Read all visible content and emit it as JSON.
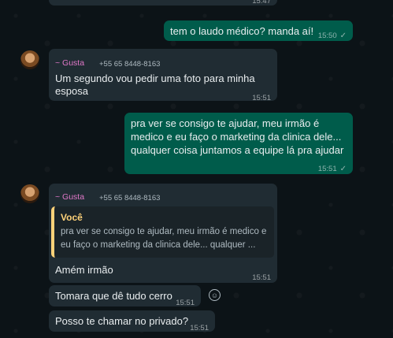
{
  "messages": {
    "top_partial": {
      "time": "15:47"
    },
    "m1": {
      "text": "tem o laudo médico? manda aí!",
      "time": "15:50",
      "status": "✓"
    },
    "m2": {
      "sender": "~ Gusta",
      "phone": "+55 65 8448-8163",
      "lines": [
        "Um segundo vou pedir uma foto para minha",
        "esposa"
      ],
      "time": "15:51"
    },
    "m3": {
      "lines": [
        "pra ver se consigo te ajudar, meu irmão é",
        "medico e eu faço o marketing da clinica dele...",
        "qualquer coisa juntamos a equipe lá pra ajudar"
      ],
      "time": "15:51",
      "status": "✓"
    },
    "m4": {
      "sender": "~ Gusta",
      "phone": "+55 65 8448-8163",
      "quote_author": "Você",
      "quote_lines": [
        "pra ver se consigo te ajudar, meu irmão é medico e",
        "eu faço o marketing da clinica dele... qualquer ..."
      ],
      "text": "Amém irmão",
      "time": "15:51"
    },
    "m5": {
      "text": "Tomara que dê tudo cerro",
      "time": "15:51"
    },
    "m6": {
      "text": "Posso te chamar no privado?",
      "time": "15:51"
    }
  },
  "icons": {
    "emoji_reaction": "smiley-icon"
  },
  "colors": {
    "outgoing": "#005c4b",
    "incoming": "#202c33",
    "sender": "#e078c8",
    "quote_bar": "#ffd279"
  }
}
